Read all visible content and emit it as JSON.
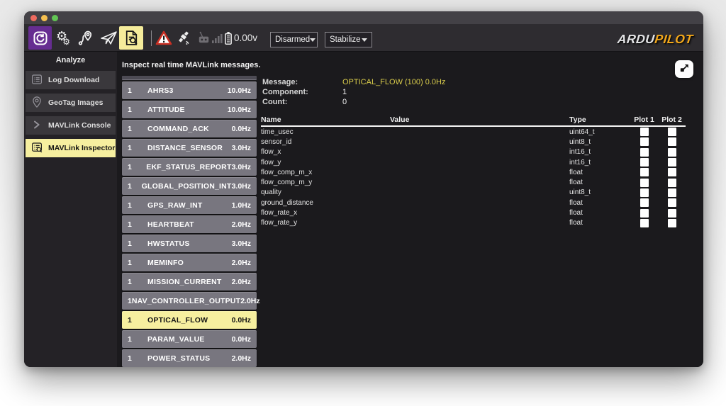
{
  "colors": {
    "accent_yellow": "#f6ef9f",
    "value_yellow": "#d9cc4b",
    "purple": "#662d91",
    "traffic_red": "#ed6a5f",
    "traffic_yellow": "#f5bf4f",
    "traffic_green": "#62c554",
    "list_item_gray": "#78767f"
  },
  "toolbar": {
    "voltage": "0.00v",
    "arm_state": "Disarmed",
    "flight_mode": "Stabilize",
    "logo_left": "ARDU",
    "logo_right": "PILOT"
  },
  "sidebar": {
    "title": "Analyze",
    "items": [
      {
        "label": "Log Download"
      },
      {
        "label": "GeoTag Images"
      },
      {
        "label": "MAVLink Console"
      },
      {
        "label": "MAVLink Inspector",
        "active": true
      }
    ]
  },
  "main": {
    "subtitle": "Inspect real time MAVLink messages.",
    "message_list": [
      {
        "count": "1",
        "name": "AHRS3",
        "rate": "10.0Hz"
      },
      {
        "count": "1",
        "name": "ATTITUDE",
        "rate": "10.0Hz"
      },
      {
        "count": "1",
        "name": "COMMAND_ACK",
        "rate": "0.0Hz"
      },
      {
        "count": "1",
        "name": "DISTANCE_SENSOR",
        "rate": "3.0Hz"
      },
      {
        "count": "1",
        "name": "EKF_STATUS_REPORT",
        "rate": "3.0Hz"
      },
      {
        "count": "1",
        "name": "GLOBAL_POSITION_INT",
        "rate": "3.0Hz"
      },
      {
        "count": "1",
        "name": "GPS_RAW_INT",
        "rate": "1.0Hz"
      },
      {
        "count": "1",
        "name": "HEARTBEAT",
        "rate": "2.0Hz"
      },
      {
        "count": "1",
        "name": "HWSTATUS",
        "rate": "3.0Hz"
      },
      {
        "count": "1",
        "name": "MEMINFO",
        "rate": "2.0Hz"
      },
      {
        "count": "1",
        "name": "MISSION_CURRENT",
        "rate": "2.0Hz"
      },
      {
        "count": "1",
        "name": "NAV_CONTROLLER_OUTPUT",
        "rate": "2.0Hz"
      },
      {
        "count": "1",
        "name": "OPTICAL_FLOW",
        "rate": "0.0Hz",
        "selected": true
      },
      {
        "count": "1",
        "name": "PARAM_VALUE",
        "rate": "0.0Hz"
      },
      {
        "count": "1",
        "name": "POWER_STATUS",
        "rate": "2.0Hz"
      }
    ],
    "detail": {
      "message_label": "Message:",
      "message_value": "OPTICAL_FLOW (100) 0.0Hz",
      "component_label": "Component:",
      "component_value": "1",
      "count_label": "Count:",
      "count_value": "0",
      "table": {
        "headers": {
          "name": "Name",
          "value": "Value",
          "type": "Type",
          "plot1": "Plot 1",
          "plot2": "Plot 2"
        },
        "rows": [
          {
            "name": "time_usec",
            "value": "",
            "type": "uint64_t"
          },
          {
            "name": "sensor_id",
            "value": "",
            "type": "uint8_t"
          },
          {
            "name": "flow_x",
            "value": "",
            "type": "int16_t"
          },
          {
            "name": "flow_y",
            "value": "",
            "type": "int16_t"
          },
          {
            "name": "flow_comp_m_x",
            "value": "",
            "type": "float"
          },
          {
            "name": "flow_comp_m_y",
            "value": "",
            "type": "float"
          },
          {
            "name": "quality",
            "value": "",
            "type": "uint8_t"
          },
          {
            "name": "ground_distance",
            "value": "",
            "type": "float"
          },
          {
            "name": "flow_rate_x",
            "value": "",
            "type": "float"
          },
          {
            "name": "flow_rate_y",
            "value": "",
            "type": "float"
          }
        ]
      }
    }
  }
}
